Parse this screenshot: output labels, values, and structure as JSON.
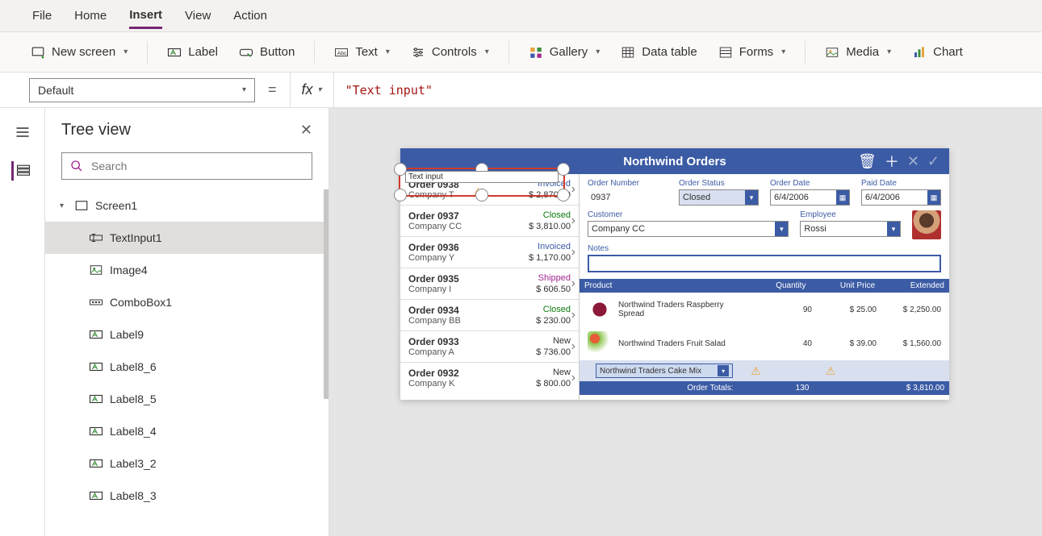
{
  "menu": {
    "file": "File",
    "home": "Home",
    "insert": "Insert",
    "view": "View",
    "action": "Action"
  },
  "ribbon": {
    "newscreen": "New screen",
    "label": "Label",
    "button": "Button",
    "text": "Text",
    "controls": "Controls",
    "gallery": "Gallery",
    "datatable": "Data table",
    "forms": "Forms",
    "media": "Media",
    "chart": "Chart"
  },
  "formula": {
    "property": "Default",
    "value": "\"Text input\""
  },
  "tree": {
    "title": "Tree view",
    "search_ph": "Search",
    "items": [
      {
        "name": "Screen1",
        "type": "screen",
        "level": 1,
        "expanded": true
      },
      {
        "name": "TextInput1",
        "type": "textinput",
        "level": 2,
        "selected": true
      },
      {
        "name": "Image4",
        "type": "image",
        "level": 2
      },
      {
        "name": "ComboBox1",
        "type": "combobox",
        "level": 2
      },
      {
        "name": "Label9",
        "type": "label",
        "level": 2
      },
      {
        "name": "Label8_6",
        "type": "label",
        "level": 2
      },
      {
        "name": "Label8_5",
        "type": "label",
        "level": 2
      },
      {
        "name": "Label8_4",
        "type": "label",
        "level": 2
      },
      {
        "name": "Label3_2",
        "type": "label",
        "level": 2
      },
      {
        "name": "Label8_3",
        "type": "label",
        "level": 2
      }
    ]
  },
  "preview": {
    "title": "Northwind Orders",
    "textinput_placeholder": "Text input",
    "orders": [
      {
        "id": "Order 0938",
        "company": "Company T",
        "status": "Invoiced",
        "scls": "st-inv",
        "price": "$ 2,870.00"
      },
      {
        "id": "Order 0937",
        "company": "Company CC",
        "status": "Closed",
        "scls": "st-closed",
        "price": "$ 3,810.00"
      },
      {
        "id": "Order 0936",
        "company": "Company Y",
        "status": "Invoiced",
        "scls": "st-inv",
        "price": "$ 1,170.00"
      },
      {
        "id": "Order 0935",
        "company": "Company I",
        "status": "Shipped",
        "scls": "st-shipped",
        "price": "$ 606.50"
      },
      {
        "id": "Order 0934",
        "company": "Company BB",
        "status": "Closed",
        "scls": "st-closed",
        "price": "$ 230.00"
      },
      {
        "id": "Order 0933",
        "company": "Company A",
        "status": "New",
        "scls": "st-new",
        "price": "$ 736.00"
      },
      {
        "id": "Order 0932",
        "company": "Company K",
        "status": "New",
        "scls": "st-new",
        "price": "$ 800.00"
      }
    ],
    "detail": {
      "labels": {
        "ordernum": "Order Number",
        "orderstatus": "Order Status",
        "orderdate": "Order Date",
        "paiddate": "Paid Date",
        "customer": "Customer",
        "employee": "Employee",
        "notes": "Notes"
      },
      "ordernum": "0937",
      "orderstatus": "Closed",
      "orderdate": "6/4/2006",
      "paiddate": "6/4/2006",
      "customer": "Company CC",
      "employee": "Rossi"
    },
    "prodhead": {
      "product": "Product",
      "qty": "Quantity",
      "unit": "Unit Price",
      "ext": "Extended"
    },
    "products": [
      {
        "name": "Northwind Traders Raspberry Spread",
        "qty": "90",
        "unit": "$ 25.00",
        "ext": "$ 2,250.00",
        "img": "raspberry"
      },
      {
        "name": "Northwind Traders Fruit Salad",
        "qty": "40",
        "unit": "$ 39.00",
        "ext": "$ 1,560.00",
        "img": "fruit"
      }
    ],
    "addprod": "Northwind Traders Cake Mix",
    "totals": {
      "label": "Order Totals:",
      "qty": "130",
      "ext": "$ 3,810.00"
    }
  }
}
